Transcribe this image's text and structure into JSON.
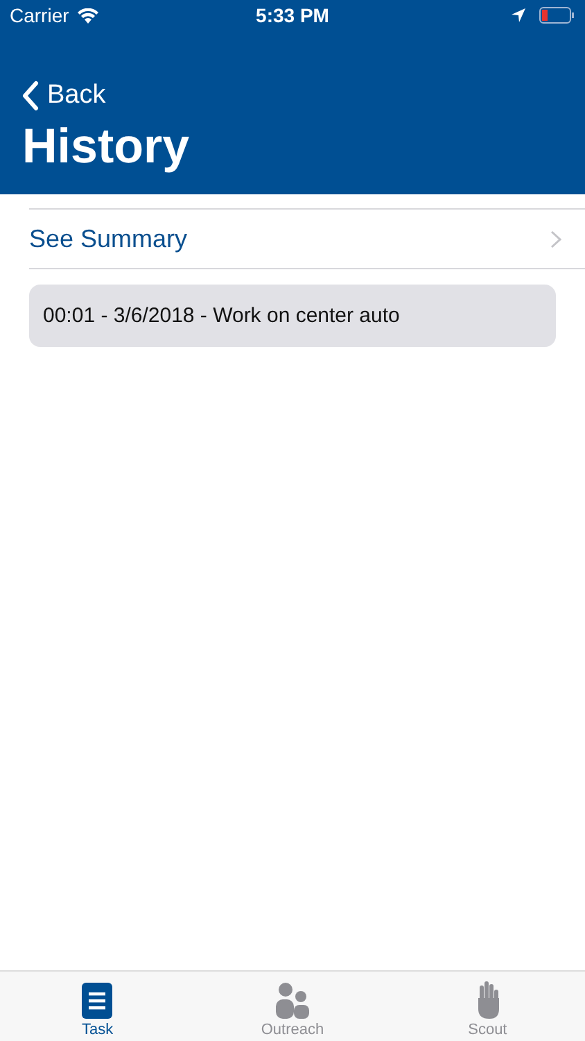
{
  "status_bar": {
    "carrier": "Carrier",
    "time": "5:33 PM"
  },
  "nav": {
    "back": "Back",
    "title": "History"
  },
  "summary_link": "See Summary",
  "entries": [
    "00:01 - 3/6/2018 - Work on center auto"
  ],
  "tabs": [
    {
      "label": "Task",
      "kind": "task",
      "selected": true
    },
    {
      "label": "Outreach",
      "kind": "outreach",
      "selected": false
    },
    {
      "label": "Scout",
      "kind": "scout",
      "selected": false
    }
  ]
}
